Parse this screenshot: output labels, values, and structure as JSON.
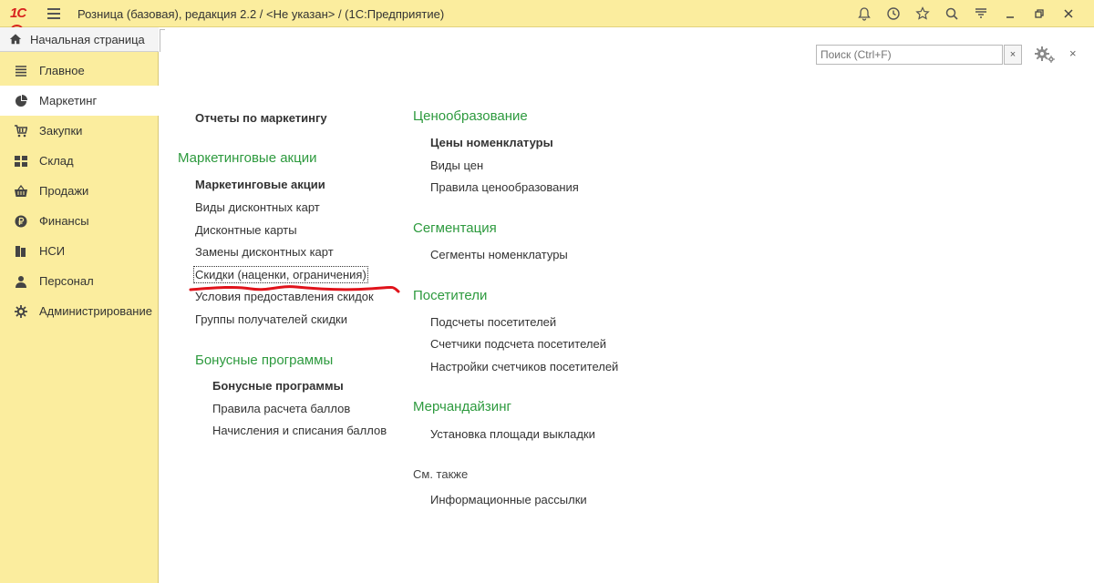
{
  "window": {
    "title": "Розница (базовая), редакция 2.2 / <Не указан> /  (1С:Предприятие)",
    "logo_text": "1С"
  },
  "home_tab": {
    "label": "Начальная страница"
  },
  "sidebar": {
    "items": [
      {
        "label": "Главное",
        "icon": "list-icon",
        "active": false
      },
      {
        "label": "Маркетинг",
        "icon": "pie-chart-icon",
        "active": true
      },
      {
        "label": "Закупки",
        "icon": "cart-icon",
        "active": false
      },
      {
        "label": "Склад",
        "icon": "warehouse-icon",
        "active": false
      },
      {
        "label": "Продажи",
        "icon": "basket-icon",
        "active": false
      },
      {
        "label": "Финансы",
        "icon": "ruble-icon",
        "active": false
      },
      {
        "label": "НСИ",
        "icon": "books-icon",
        "active": false
      },
      {
        "label": "Персонал",
        "icon": "person-icon",
        "active": false
      },
      {
        "label": "Администрирование",
        "icon": "gear-icon",
        "active": false
      }
    ]
  },
  "search": {
    "placeholder": "Поиск (Ctrl+F)",
    "clear_label": "×"
  },
  "close_label": "×",
  "left_column": {
    "top_link": "Отчеты по маркетингу",
    "marketing": {
      "title": "Маркетинговые акции",
      "items": [
        "Маркетинговые акции",
        "Виды дисконтных карт",
        "Дисконтные карты",
        "Замены дисконтных карт",
        "Скидки (наценки, ограничения)",
        "Условия предоставления скидок",
        "Группы получателей скидки"
      ]
    },
    "bonus": {
      "title": "Бонусные программы",
      "items": [
        "Бонусные программы",
        "Правила расчета баллов",
        "Начисления и списания баллов"
      ]
    }
  },
  "right_column": {
    "pricing": {
      "title": "Ценообразование",
      "items": [
        "Цены номенклатуры",
        "Виды цен",
        "Правила ценообразования"
      ]
    },
    "segmentation": {
      "title": "Сегментация",
      "items": [
        "Сегменты номенклатуры"
      ]
    },
    "visitors": {
      "title": "Посетители",
      "items": [
        "Подсчеты посетителей",
        "Счетчики подсчета посетителей",
        "Настройки счетчиков посетителей"
      ]
    },
    "merch": {
      "title": "Мерчандайзинг",
      "items": [
        "Установка площади выкладки"
      ]
    },
    "see_also": {
      "title": "См. также",
      "items": [
        "Информационные рассылки"
      ]
    }
  },
  "colors": {
    "accent_green": "#2d9a3e",
    "panel_yellow": "#fbed9e",
    "annotation_red": "#e0131b"
  }
}
